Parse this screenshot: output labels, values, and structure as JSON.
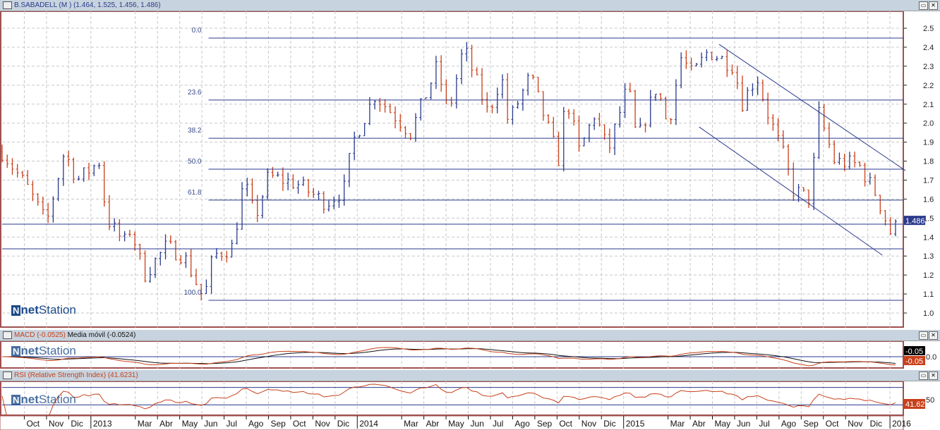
{
  "main_title": "B.SABADELL (M ) (1.464, 1.525, 1.456, 1.486)",
  "macd_title": "MACD (-0.0525)",
  "macd_ma_title": "Media móvil (-0.0524)",
  "rsi_title": "RSI (Relative Strength Index) (41.6231)",
  "logo": "netStation",
  "colors": {
    "up": "#2a3a8c",
    "down": "#c8401a",
    "line": "#2a3a8c",
    "frame": "#a05050"
  },
  "chart_data": {
    "type": "bar",
    "title": "B.SABADELL (M )",
    "ohlc_last": {
      "open": 1.464,
      "high": 1.525,
      "low": 1.456,
      "close": 1.486
    },
    "xlim": [
      0,
      40.6
    ],
    "ylim": [
      0.92,
      2.58
    ],
    "y_ticks": [
      1.0,
      1.1,
      1.2,
      1.3,
      1.4,
      1.5,
      1.6,
      1.7,
      1.8,
      1.9,
      2.0,
      2.1,
      2.2,
      2.3,
      2.4,
      2.5
    ],
    "last_price_label": "1.486",
    "x_ticks": [
      {
        "t": 1,
        "label": "Oct"
      },
      {
        "t": 2,
        "label": "Nov"
      },
      {
        "t": 3,
        "label": "Dic"
      },
      {
        "t": 4,
        "label": "2013"
      },
      {
        "t": 6,
        "label": "Mar"
      },
      {
        "t": 7,
        "label": "Abr"
      },
      {
        "t": 8,
        "label": "May"
      },
      {
        "t": 9,
        "label": "Jun"
      },
      {
        "t": 10,
        "label": "Jul"
      },
      {
        "t": 11,
        "label": "Ago"
      },
      {
        "t": 12,
        "label": "Sep"
      },
      {
        "t": 13,
        "label": "Oct"
      },
      {
        "t": 14,
        "label": "Nov"
      },
      {
        "t": 15,
        "label": "Dic"
      },
      {
        "t": 16,
        "label": "2014"
      },
      {
        "t": 18,
        "label": "Mar"
      },
      {
        "t": 19,
        "label": "Abr"
      },
      {
        "t": 20,
        "label": "May"
      },
      {
        "t": 21,
        "label": "Jun"
      },
      {
        "t": 22,
        "label": "Jul"
      },
      {
        "t": 23,
        "label": "Ago"
      },
      {
        "t": 24,
        "label": "Sep"
      },
      {
        "t": 25,
        "label": "Oct"
      },
      {
        "t": 26,
        "label": "Nov"
      },
      {
        "t": 27,
        "label": "Dic"
      },
      {
        "t": 28,
        "label": "2015"
      },
      {
        "t": 30,
        "label": "Mar"
      },
      {
        "t": 31,
        "label": "Abr"
      },
      {
        "t": 32,
        "label": "May"
      },
      {
        "t": 33,
        "label": "Jun"
      },
      {
        "t": 34,
        "label": "Jul"
      },
      {
        "t": 35,
        "label": "Ago"
      },
      {
        "t": 36,
        "label": "Sep"
      },
      {
        "t": 37,
        "label": "Oct"
      },
      {
        "t": 38,
        "label": "Nov"
      },
      {
        "t": 39,
        "label": "Dic"
      },
      {
        "t": 40,
        "label": "2016"
      }
    ],
    "price_path": [
      [
        0,
        1.85
      ],
      [
        1.2,
        1.65
      ],
      [
        2.0,
        1.47
      ],
      [
        2.8,
        1.85
      ],
      [
        3.4,
        1.7
      ],
      [
        4.4,
        1.8
      ],
      [
        4.7,
        1.5
      ],
      [
        5.5,
        1.37
      ],
      [
        5.8,
        1.45
      ],
      [
        6.4,
        1.2
      ],
      [
        7.4,
        1.35
      ],
      [
        8.2,
        1.3
      ],
      [
        9.1,
        1.07
      ],
      [
        9.5,
        1.3
      ],
      [
        10.4,
        1.35
      ],
      [
        10.9,
        1.7
      ],
      [
        11.4,
        1.5
      ],
      [
        12.0,
        1.72
      ],
      [
        13.3,
        1.68
      ],
      [
        14.6,
        1.58
      ],
      [
        15.4,
        1.65
      ],
      [
        15.8,
        1.9
      ],
      [
        16.8,
        2.15
      ],
      [
        18.4,
        1.95
      ],
      [
        19.6,
        2.3
      ],
      [
        20.1,
        2.05
      ],
      [
        20.8,
        2.4
      ],
      [
        21.9,
        2.05
      ],
      [
        22.5,
        2.25
      ],
      [
        22.8,
        2.0
      ],
      [
        23.8,
        2.25
      ],
      [
        25.1,
        1.8
      ],
      [
        25.4,
        2.15
      ],
      [
        26.0,
        1.85
      ],
      [
        26.7,
        2.05
      ],
      [
        27.3,
        1.85
      ],
      [
        28.2,
        2.2
      ],
      [
        28.6,
        1.9
      ],
      [
        29.5,
        2.2
      ],
      [
        30.0,
        1.98
      ],
      [
        30.6,
        2.35
      ],
      [
        31.1,
        2.25
      ],
      [
        31.8,
        2.38
      ],
      [
        33.0,
        2.3
      ],
      [
        33.3,
        2.1
      ],
      [
        34.0,
        2.25
      ],
      [
        34.5,
        2.05
      ],
      [
        35.3,
        1.8
      ],
      [
        35.6,
        1.65
      ],
      [
        36.4,
        1.6
      ],
      [
        36.8,
        2.05
      ],
      [
        37.5,
        1.8
      ],
      [
        38.6,
        1.78
      ],
      [
        39.4,
        1.62
      ],
      [
        40.1,
        1.4
      ],
      [
        40.35,
        1.486
      ]
    ],
    "fibonacci": {
      "high": 2.448,
      "low": 1.067,
      "start_t": 9.3,
      "levels": [
        {
          "pct": 0,
          "label": "0.0"
        },
        {
          "pct": 23.6,
          "label": "23.6"
        },
        {
          "pct": 38.2,
          "label": "38.2"
        },
        {
          "pct": 50,
          "label": "50.0"
        },
        {
          "pct": 61.8,
          "label": "61.8"
        },
        {
          "pct": 100,
          "label": "100.0"
        }
      ]
    },
    "horizontal_lines": [
      1.468,
      1.338
    ],
    "channel": [
      [
        [
          32.3,
          2.415
        ],
        [
          40.7,
          1.75
        ]
      ],
      [
        [
          31.4,
          1.98
        ],
        [
          39.65,
          1.305
        ]
      ]
    ],
    "macd": {
      "value_label": "-0.05",
      "signal_label": "-0.05",
      "zero_label": "0.0"
    },
    "rsi": {
      "value_label": "41.62",
      "mid_label": "50",
      "levels": [
        30,
        70
      ]
    }
  }
}
